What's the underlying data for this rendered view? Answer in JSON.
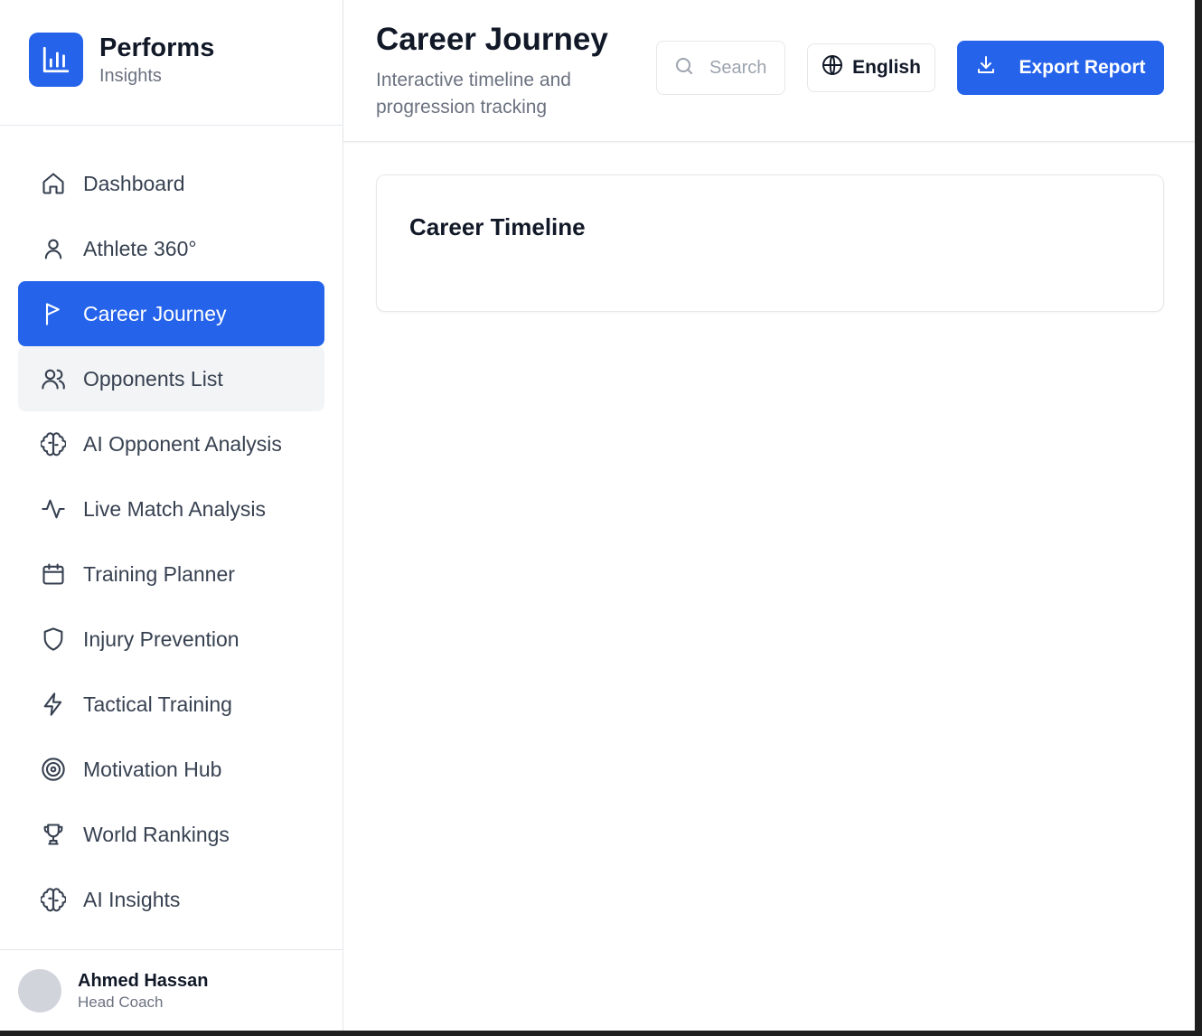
{
  "brand": {
    "name": "Performs",
    "subtitle": "Insights",
    "color": "#2563eb",
    "icon": "bar-chart-icon"
  },
  "nav": {
    "items": [
      {
        "label": "Dashboard",
        "icon": "home-icon"
      },
      {
        "label": "Athlete 360°",
        "icon": "user-icon"
      },
      {
        "label": "Career Journey",
        "icon": "flag-icon",
        "active": true
      },
      {
        "label": "Opponents List",
        "icon": "users-icon",
        "hover": true
      },
      {
        "label": "AI Opponent Analysis",
        "icon": "brain-icon"
      },
      {
        "label": "Live Match Analysis",
        "icon": "activity-icon"
      },
      {
        "label": "Training Planner",
        "icon": "calendar-icon"
      },
      {
        "label": "Injury Prevention",
        "icon": "shield-icon"
      },
      {
        "label": "Tactical Training",
        "icon": "zap-icon"
      },
      {
        "label": "Motivation Hub",
        "icon": "target-icon"
      },
      {
        "label": "World Rankings",
        "icon": "trophy-icon"
      },
      {
        "label": "AI Insights",
        "icon": "brain-icon"
      }
    ]
  },
  "user": {
    "name": "Ahmed Hassan",
    "role": "Head Coach"
  },
  "header": {
    "title": "Career Journey",
    "subtitle": "Interactive timeline and progression tracking",
    "search_placeholder": "Search...",
    "language_label": "English",
    "export_label": "Export Report"
  },
  "card": {
    "title": "Career Timeline"
  },
  "colors": {
    "accent": "#2563eb",
    "hover_bg": "#f3f4f6",
    "border": "#e5e7eb",
    "muted": "#6b7280"
  }
}
